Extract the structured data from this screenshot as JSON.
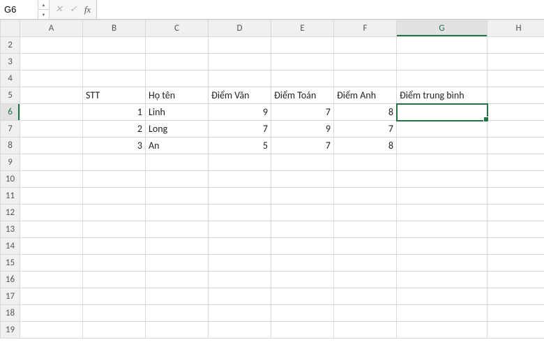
{
  "formula_bar": {
    "name_box": "G6",
    "cancel": "✕",
    "enter": "✓",
    "fx_label": "fx",
    "formula": ""
  },
  "columns": [
    "A",
    "B",
    "C",
    "D",
    "E",
    "F",
    "G",
    "H"
  ],
  "rows": [
    "2",
    "3",
    "4",
    "5",
    "6",
    "7",
    "8",
    "9",
    "10",
    "11",
    "12",
    "13",
    "14",
    "15",
    "16",
    "17",
    "18",
    "19"
  ],
  "selected_cell": "G6",
  "selected_col": "G",
  "selected_row": "6",
  "table": {
    "headers": {
      "stt": "STT",
      "ho_ten": "Họ tên",
      "diem_van": "Điểm Văn",
      "diem_toan": "Điểm Toán",
      "diem_anh": "Điểm Anh",
      "diem_tb": "Điểm trung bình"
    },
    "rows": [
      {
        "stt": "1",
        "ho_ten": "Linh",
        "van": "9",
        "toan": "7",
        "anh": "8",
        "tb": ""
      },
      {
        "stt": "2",
        "ho_ten": "Long",
        "van": "7",
        "toan": "9",
        "anh": "7",
        "tb": ""
      },
      {
        "stt": "3",
        "ho_ten": "An",
        "van": "5",
        "toan": "7",
        "anh": "8",
        "tb": ""
      }
    ]
  },
  "chart_data": {
    "type": "table",
    "title": "",
    "columns": [
      "STT",
      "Họ tên",
      "Điểm Văn",
      "Điểm Toán",
      "Điểm Anh",
      "Điểm trung bình"
    ],
    "rows": [
      [
        1,
        "Linh",
        9,
        7,
        8,
        null
      ],
      [
        2,
        "Long",
        7,
        9,
        7,
        null
      ],
      [
        3,
        "An",
        5,
        7,
        8,
        null
      ]
    ]
  }
}
